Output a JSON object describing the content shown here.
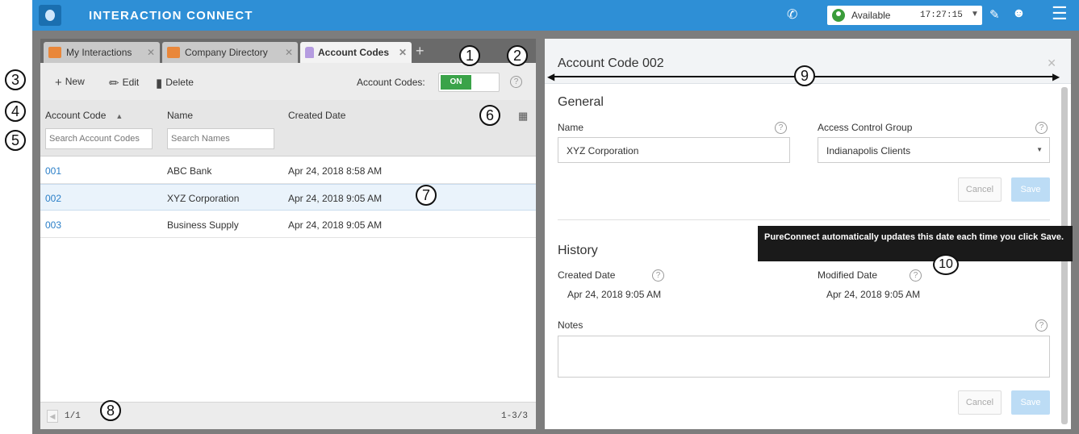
{
  "app": {
    "title": "INTERACTION CONNECT",
    "status": "Available",
    "time": "17:27:15"
  },
  "tabs": [
    {
      "label": "My Interactions"
    },
    {
      "label": "Company Directory"
    },
    {
      "label": "Account Codes"
    }
  ],
  "toolbar": {
    "new_label": "New",
    "edit_label": "Edit",
    "delete_label": "Delete",
    "account_codes_label": "Account Codes:",
    "toggle_value": "ON"
  },
  "table": {
    "columns": [
      "Account Code",
      "Name",
      "Created Date"
    ],
    "search_code_placeholder": "Search Account Codes",
    "search_name_placeholder": "Search Names",
    "rows": [
      {
        "code": "001",
        "name": "ABC Bank",
        "date": "Apr 24, 2018 8:58 AM"
      },
      {
        "code": "002",
        "name": "XYZ Corporation",
        "date": "Apr 24, 2018 9:05 AM"
      },
      {
        "code": "003",
        "name": "Business Supply",
        "date": "Apr 24, 2018 9:05 AM"
      }
    ]
  },
  "pager": {
    "page": "1/1",
    "range": "1-3/3"
  },
  "detail": {
    "title": "Account Code 002",
    "general": {
      "heading": "General",
      "name_label": "Name",
      "name_value": "XYZ Corporation",
      "acg_label": "Access Control Group",
      "acg_value": "Indianapolis Clients",
      "cancel_label": "Cancel",
      "save_label": "Save"
    },
    "history": {
      "heading": "History",
      "created_label": "Created Date",
      "created_value": "Apr 24, 2018 9:05 AM",
      "modified_label": "Modified Date",
      "modified_value": "Apr 24, 2018 9:05 AM"
    },
    "notes_label": "Notes",
    "cancel_label": "Cancel",
    "save_label": "Save",
    "tooltip": "PureConnect automatically updates this date each time you click Save."
  },
  "callouts": [
    "1",
    "2",
    "3",
    "4",
    "5",
    "6",
    "7",
    "8",
    "9",
    "10"
  ]
}
